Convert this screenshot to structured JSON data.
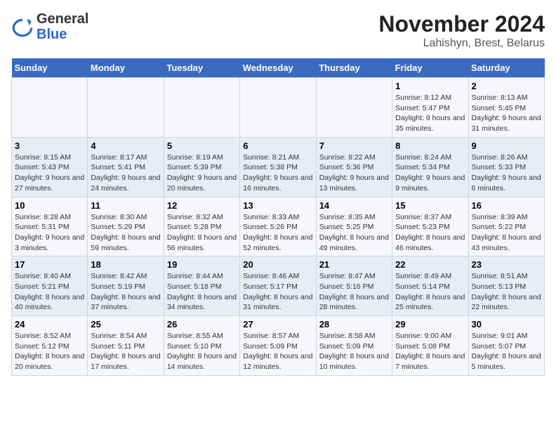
{
  "logo": {
    "text_general": "General",
    "text_blue": "Blue"
  },
  "title": "November 2024",
  "subtitle": "Lahishyn, Brest, Belarus",
  "days_of_week": [
    "Sunday",
    "Monday",
    "Tuesday",
    "Wednesday",
    "Thursday",
    "Friday",
    "Saturday"
  ],
  "weeks": [
    [
      {
        "day": "",
        "info": ""
      },
      {
        "day": "",
        "info": ""
      },
      {
        "day": "",
        "info": ""
      },
      {
        "day": "",
        "info": ""
      },
      {
        "day": "",
        "info": ""
      },
      {
        "day": "1",
        "info": "Sunrise: 8:12 AM\nSunset: 5:47 PM\nDaylight: 9 hours and 35 minutes."
      },
      {
        "day": "2",
        "info": "Sunrise: 8:13 AM\nSunset: 5:45 PM\nDaylight: 9 hours and 31 minutes."
      }
    ],
    [
      {
        "day": "3",
        "info": "Sunrise: 8:15 AM\nSunset: 5:43 PM\nDaylight: 9 hours and 27 minutes."
      },
      {
        "day": "4",
        "info": "Sunrise: 8:17 AM\nSunset: 5:41 PM\nDaylight: 9 hours and 24 minutes."
      },
      {
        "day": "5",
        "info": "Sunrise: 8:19 AM\nSunset: 5:39 PM\nDaylight: 9 hours and 20 minutes."
      },
      {
        "day": "6",
        "info": "Sunrise: 8:21 AM\nSunset: 5:38 PM\nDaylight: 9 hours and 16 minutes."
      },
      {
        "day": "7",
        "info": "Sunrise: 8:22 AM\nSunset: 5:36 PM\nDaylight: 9 hours and 13 minutes."
      },
      {
        "day": "8",
        "info": "Sunrise: 8:24 AM\nSunset: 5:34 PM\nDaylight: 9 hours and 9 minutes."
      },
      {
        "day": "9",
        "info": "Sunrise: 8:26 AM\nSunset: 5:33 PM\nDaylight: 9 hours and 6 minutes."
      }
    ],
    [
      {
        "day": "10",
        "info": "Sunrise: 8:28 AM\nSunset: 5:31 PM\nDaylight: 9 hours and 3 minutes."
      },
      {
        "day": "11",
        "info": "Sunrise: 8:30 AM\nSunset: 5:29 PM\nDaylight: 8 hours and 59 minutes."
      },
      {
        "day": "12",
        "info": "Sunrise: 8:32 AM\nSunset: 5:28 PM\nDaylight: 8 hours and 56 minutes."
      },
      {
        "day": "13",
        "info": "Sunrise: 8:33 AM\nSunset: 5:26 PM\nDaylight: 8 hours and 52 minutes."
      },
      {
        "day": "14",
        "info": "Sunrise: 8:35 AM\nSunset: 5:25 PM\nDaylight: 8 hours and 49 minutes."
      },
      {
        "day": "15",
        "info": "Sunrise: 8:37 AM\nSunset: 5:23 PM\nDaylight: 8 hours and 46 minutes."
      },
      {
        "day": "16",
        "info": "Sunrise: 8:39 AM\nSunset: 5:22 PM\nDaylight: 8 hours and 43 minutes."
      }
    ],
    [
      {
        "day": "17",
        "info": "Sunrise: 8:40 AM\nSunset: 5:21 PM\nDaylight: 8 hours and 40 minutes."
      },
      {
        "day": "18",
        "info": "Sunrise: 8:42 AM\nSunset: 5:19 PM\nDaylight: 8 hours and 37 minutes."
      },
      {
        "day": "19",
        "info": "Sunrise: 8:44 AM\nSunset: 5:18 PM\nDaylight: 8 hours and 34 minutes."
      },
      {
        "day": "20",
        "info": "Sunrise: 8:46 AM\nSunset: 5:17 PM\nDaylight: 8 hours and 31 minutes."
      },
      {
        "day": "21",
        "info": "Sunrise: 8:47 AM\nSunset: 5:16 PM\nDaylight: 8 hours and 28 minutes."
      },
      {
        "day": "22",
        "info": "Sunrise: 8:49 AM\nSunset: 5:14 PM\nDaylight: 8 hours and 25 minutes."
      },
      {
        "day": "23",
        "info": "Sunrise: 8:51 AM\nSunset: 5:13 PM\nDaylight: 8 hours and 22 minutes."
      }
    ],
    [
      {
        "day": "24",
        "info": "Sunrise: 8:52 AM\nSunset: 5:12 PM\nDaylight: 8 hours and 20 minutes."
      },
      {
        "day": "25",
        "info": "Sunrise: 8:54 AM\nSunset: 5:11 PM\nDaylight: 8 hours and 17 minutes."
      },
      {
        "day": "26",
        "info": "Sunrise: 8:55 AM\nSunset: 5:10 PM\nDaylight: 8 hours and 14 minutes."
      },
      {
        "day": "27",
        "info": "Sunrise: 8:57 AM\nSunset: 5:09 PM\nDaylight: 8 hours and 12 minutes."
      },
      {
        "day": "28",
        "info": "Sunrise: 8:58 AM\nSunset: 5:09 PM\nDaylight: 8 hours and 10 minutes."
      },
      {
        "day": "29",
        "info": "Sunrise: 9:00 AM\nSunset: 5:08 PM\nDaylight: 8 hours and 7 minutes."
      },
      {
        "day": "30",
        "info": "Sunrise: 9:01 AM\nSunset: 5:07 PM\nDaylight: 8 hours and 5 minutes."
      }
    ]
  ]
}
